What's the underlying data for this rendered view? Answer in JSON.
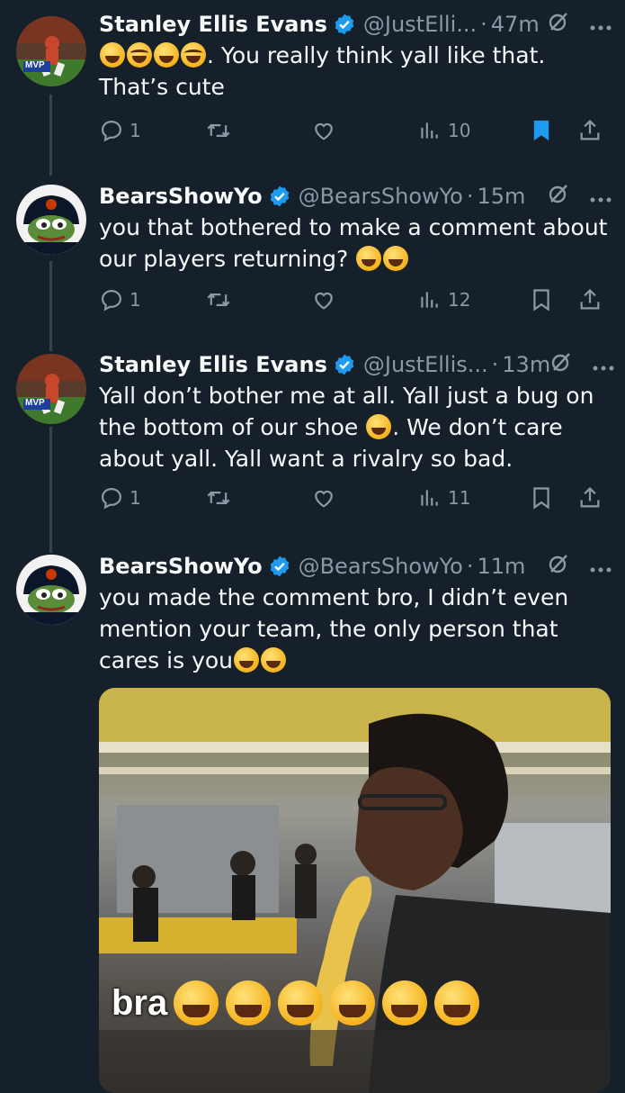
{
  "tweets": [
    {
      "name": "Stanley Ellis Evans",
      "handle": "@JustElli...",
      "dot": "·",
      "time": "47m",
      "avatar_text": "MVP",
      "text_after_emoji": ". You really think yall like that. That’s cute",
      "replies": "1",
      "retweets": "",
      "likes": "",
      "views": "10",
      "bookmarked": true
    },
    {
      "name": "BearsShowYo",
      "handle": "@BearsShowYo",
      "dot": "·",
      "time": "15m",
      "text": "you that bothered to make a comment about our players returning? ",
      "replies": "1",
      "views": "12",
      "bookmarked": false
    },
    {
      "name": "Stanley Ellis Evans",
      "handle": "@JustEllis...",
      "dot": "·",
      "time": "13m",
      "avatar_text": "MVP",
      "text_before": "Yall don’t bother me at all. Yall just a bug on the bottom of our shoe ",
      "text_after": ". We don’t care about yall. Yall want a rivalry so bad.",
      "replies": "1",
      "views": "11",
      "bookmarked": false
    },
    {
      "name": "BearsShowYo",
      "handle": "@BearsShowYo",
      "dot": "·",
      "time": "11m",
      "text": "you made the comment bro, I didn’t even mention your team, the only person that cares is you",
      "media_caption": "bra"
    }
  ],
  "colors": {
    "background": "#15202b",
    "text": "#f7f9f9",
    "secondary": "#8b98a5",
    "verified": "#1d9bf0",
    "bookmark_active": "#1d9bf0",
    "thread_line": "#38444d"
  },
  "icons": [
    "verified-badge-icon",
    "grok-icon",
    "more-icon",
    "reply-icon",
    "retweet-icon",
    "like-icon",
    "views-icon",
    "bookmark-icon",
    "share-icon",
    "laughing-emoji",
    "crying-emoji"
  ]
}
